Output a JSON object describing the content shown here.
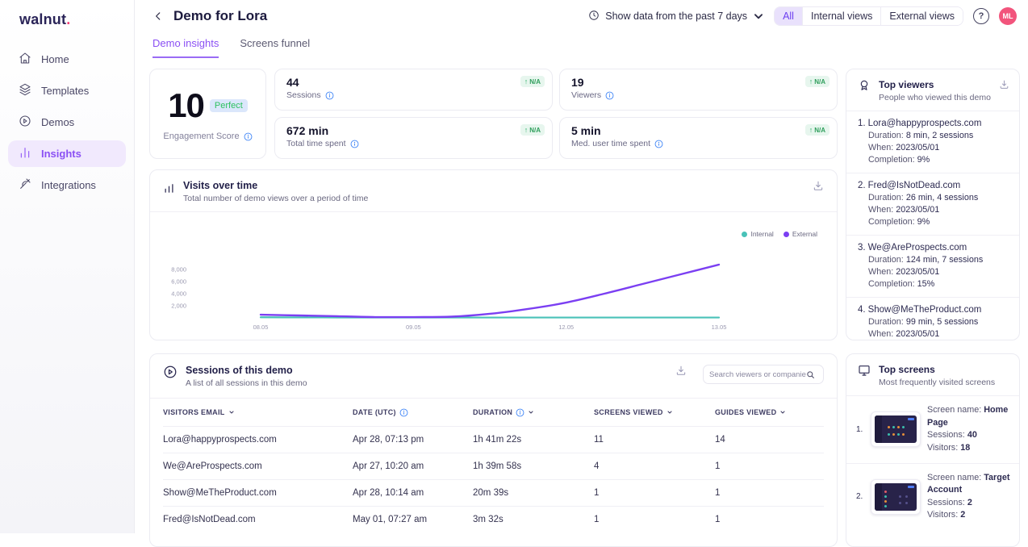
{
  "sidebar": {
    "logo": "walnut",
    "logo_dot": ".",
    "items": [
      {
        "label": "Home"
      },
      {
        "label": "Templates"
      },
      {
        "label": "Demos"
      },
      {
        "label": "Insights",
        "active": true
      },
      {
        "label": "Integrations"
      }
    ]
  },
  "header": {
    "title": "Demo for Lora",
    "date_filter": "Show data from the past 7 days",
    "view_filter": {
      "options": [
        "All",
        "Internal views",
        "External views"
      ],
      "selected": "All"
    },
    "avatar_initials": "ML",
    "help_label": "?"
  },
  "tabs": [
    {
      "label": "Demo insights",
      "active": true
    },
    {
      "label": "Screens funnel",
      "active": false
    }
  ],
  "engagement": {
    "score": "10",
    "badge": "Perfect",
    "label": "Engagement Score"
  },
  "stats": [
    {
      "value": "44",
      "label": "Sessions",
      "delta_arrow": "↑",
      "delta": "N/A"
    },
    {
      "value": "19",
      "label": "Viewers",
      "delta_arrow": "↑",
      "delta": "N/A"
    },
    {
      "value": "672 min",
      "label": "Total time spent",
      "delta_arrow": "↑",
      "delta": "N/A"
    },
    {
      "value": "5 min",
      "label": "Med. user time spent",
      "delta_arrow": "↑",
      "delta": "N/A"
    }
  ],
  "chart": {
    "title": "Visits over time",
    "subtitle": "Total number of demo views over a period of time"
  },
  "chart_data": {
    "type": "line",
    "title": "Visits over time",
    "x_tick_labels": [
      "08.05",
      "09.05",
      "12.05",
      "13.05"
    ],
    "x_tick_indices": [
      0,
      4,
      8,
      12
    ],
    "y_ticks": [
      2000,
      4000,
      6000,
      8000
    ],
    "y_tick_labels": [
      "2,000",
      "4,000",
      "6,000",
      "8,000"
    ],
    "ylim": [
      0,
      9300
    ],
    "grid": false,
    "legend_position": "top-right",
    "series": [
      {
        "name": "Internal",
        "color": "#49c2b8",
        "values": [
          100,
          80,
          70,
          60,
          60,
          60,
          60,
          60,
          60,
          60,
          60,
          60,
          60
        ]
      },
      {
        "name": "External",
        "color": "#7b3ff2",
        "values": [
          530,
          400,
          270,
          130,
          130,
          200,
          670,
          1470,
          2530,
          4000,
          5600,
          7200,
          8800
        ]
      }
    ]
  },
  "sessions": {
    "title": "Sessions of this demo",
    "subtitle": "A list of all sessions in this demo",
    "search_placeholder": "Search viewers or companies",
    "columns": [
      "Visitors email",
      "Date (UTC)",
      "Duration",
      "Screens viewed",
      "Guides viewed"
    ],
    "rows": [
      [
        "Lora@happyprospects.com",
        "Apr 28, 07:13 pm",
        "1h 41m 22s",
        "11",
        "14"
      ],
      [
        "We@AreProspects.com",
        "Apr 27, 10:20 am",
        "1h 39m 58s",
        "4",
        "1"
      ],
      [
        "Show@MeTheProduct.com",
        "Apr 28, 10:14 am",
        "20m 39s",
        "1",
        "1"
      ],
      [
        "Fred@IsNotDead.com",
        "May 01, 07:27 am",
        "3m 32s",
        "1",
        "1"
      ]
    ]
  },
  "top_viewers": {
    "title": "Top viewers",
    "subtitle": "People who viewed this demo",
    "entries": [
      {
        "rank": "1.",
        "email": "Lora@happyprospects.com",
        "lines": [
          {
            "label": "Duration: ",
            "value": "8 min, 2 sessions"
          },
          {
            "label": "When: ",
            "value": "2023/05/01"
          },
          {
            "label": "Completion: ",
            "value": "9%"
          }
        ]
      },
      {
        "rank": "2.",
        "email": "Fred@IsNotDead.com",
        "lines": [
          {
            "label": "Duration: ",
            "value": "26 min, 4 sessions"
          },
          {
            "label": "When: ",
            "value": "2023/05/01"
          },
          {
            "label": "Completion: ",
            "value": "9%"
          }
        ]
      },
      {
        "rank": "3.",
        "email": "We@AreProspects.com",
        "lines": [
          {
            "label": "Duration: ",
            "value": "124 min, 7 sessions"
          },
          {
            "label": "When: ",
            "value": "2023/05/01"
          },
          {
            "label": "Completion: ",
            "value": "15%"
          }
        ]
      },
      {
        "rank": "4.",
        "email": "Show@MeTheProduct.com",
        "lines": [
          {
            "label": "Duration: ",
            "value": "99 min, 5 sessions"
          },
          {
            "label": "When: ",
            "value": "2023/05/01"
          }
        ]
      }
    ]
  },
  "top_screens": {
    "title": "Top screens",
    "subtitle": "Most frequently visited screens",
    "entries": [
      {
        "rank": "1.",
        "name_label": "Screen name: ",
        "name": "Home Page",
        "sessions_label": "Sessions: ",
        "sessions": "40",
        "visitors_label": "Visitors: ",
        "visitors": "18"
      },
      {
        "rank": "2.",
        "name_label": "Screen name: ",
        "name": "Target Account",
        "sessions_label": "Sessions: ",
        "sessions": "2",
        "visitors_label": "Visitors: ",
        "visitors": "2"
      }
    ]
  }
}
